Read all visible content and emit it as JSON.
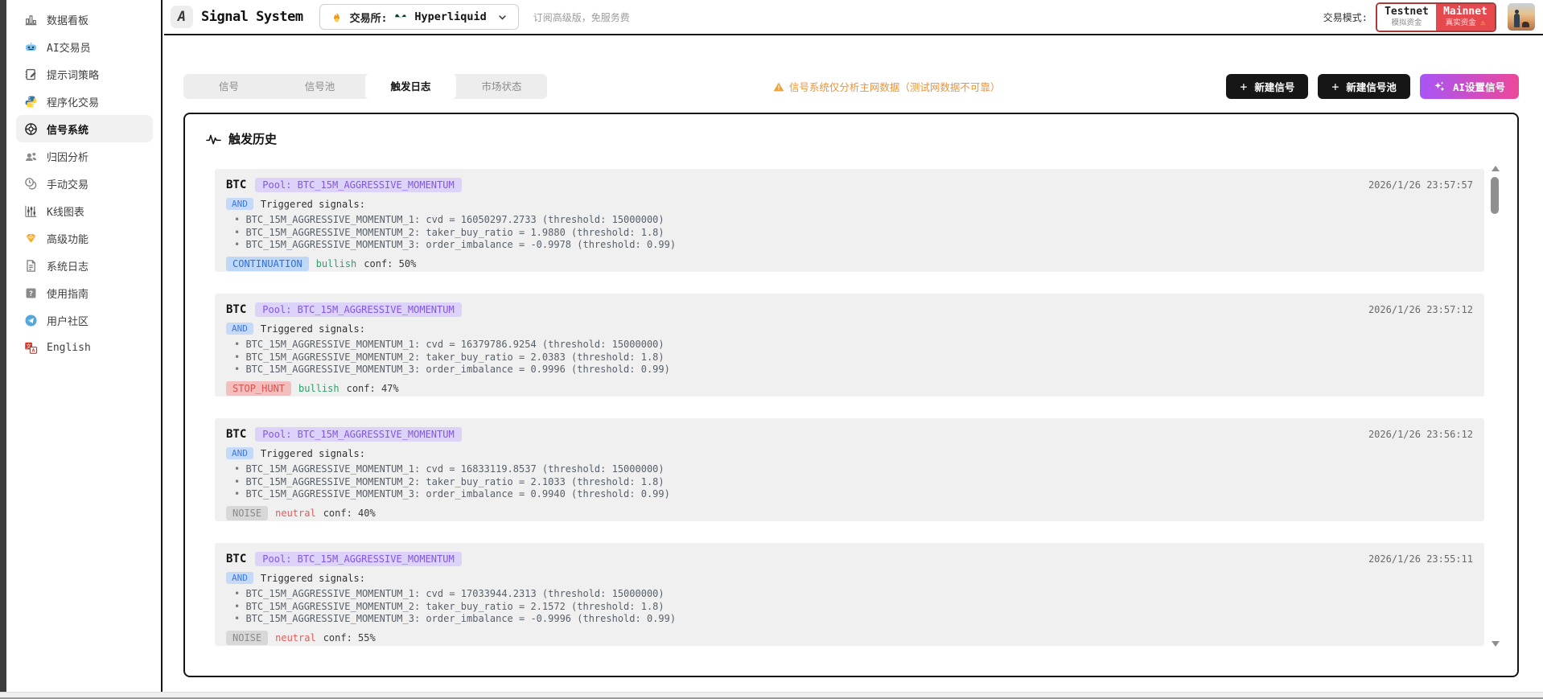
{
  "app": {
    "title": "Signal System",
    "logo_letter": "A"
  },
  "header": {
    "exchange_label": "交易所:",
    "exchange_value": "Hyperliquid",
    "promo": "订阅高级版，免服务费",
    "mode_label": "交易模式:",
    "testnet_title": "Testnet",
    "testnet_sub": "模拟资金",
    "mainnet_title": "Mainnet",
    "mainnet_sub": "真实资金",
    "mainnet_warn": "⚠"
  },
  "sidebar": {
    "items": [
      {
        "key": "dashboard",
        "icon": "bar-chart",
        "label": "数据看板",
        "active": false
      },
      {
        "key": "ai-trader",
        "icon": "robot",
        "label": "AI交易员",
        "active": false
      },
      {
        "key": "prompt-strategy",
        "icon": "notebook",
        "label": "提示词策略",
        "active": false
      },
      {
        "key": "programmatic-trading",
        "icon": "python",
        "label": "程序化交易",
        "active": false
      },
      {
        "key": "signal-system",
        "icon": "target",
        "label": "信号系统",
        "active": true
      },
      {
        "key": "attribution-analysis",
        "icon": "people",
        "label": "归因分析",
        "active": false
      },
      {
        "key": "manual-trading",
        "icon": "coins",
        "label": "手动交易",
        "active": false
      },
      {
        "key": "kline-chart",
        "icon": "candles",
        "label": "K线图表",
        "active": false
      },
      {
        "key": "advanced-features",
        "icon": "gem",
        "label": "高级功能",
        "active": false
      },
      {
        "key": "system-logs",
        "icon": "document",
        "label": "系统日志",
        "active": false
      },
      {
        "key": "user-guide",
        "icon": "question",
        "label": "使用指南",
        "active": false
      },
      {
        "key": "community",
        "icon": "telegram",
        "label": "用户社区",
        "active": false
      },
      {
        "key": "english",
        "icon": "translate",
        "label": "English",
        "active": false
      }
    ]
  },
  "tabs": [
    {
      "key": "signals",
      "label": "信号",
      "active": false
    },
    {
      "key": "signal-pools",
      "label": "信号池",
      "active": false
    },
    {
      "key": "trigger-log",
      "label": "触发日志",
      "active": true
    },
    {
      "key": "market-state",
      "label": "市场状态",
      "active": false
    }
  ],
  "warning": "信号系统仅分析主网数据（测试网数据不可靠）",
  "actions": {
    "new_signal": "新建信号",
    "new_pool": "新建信号池",
    "ai_setup": "AI设置信号"
  },
  "panel": {
    "title": "触发历史"
  },
  "cards": [
    {
      "symbol": "BTC",
      "pool": "Pool: BTC_15M_AGGRESSIVE_MOMENTUM",
      "time": "2026/1/26 23:57:57",
      "logic": "AND",
      "heading": "Triggered signals:",
      "signals": [
        "BTC_15M_AGGRESSIVE_MOMENTUM_1: cvd = 16050297.2733 (threshold: 15000000)",
        "BTC_15M_AGGRESSIVE_MOMENTUM_2: taker_buy_ratio = 1.9880 (threshold: 1.8)",
        "BTC_15M_AGGRESSIVE_MOMENTUM_3: order_imbalance = -0.9978 (threshold: 0.99)"
      ],
      "classification": "CONTINUATION",
      "class_style": "blue",
      "sentiment": "bullish",
      "sentiment_style": "green",
      "conf": "conf: 50%"
    },
    {
      "symbol": "BTC",
      "pool": "Pool: BTC_15M_AGGRESSIVE_MOMENTUM",
      "time": "2026/1/26 23:57:12",
      "logic": "AND",
      "heading": "Triggered signals:",
      "signals": [
        "BTC_15M_AGGRESSIVE_MOMENTUM_1: cvd = 16379786.9254 (threshold: 15000000)",
        "BTC_15M_AGGRESSIVE_MOMENTUM_2: taker_buy_ratio = 2.0383 (threshold: 1.8)",
        "BTC_15M_AGGRESSIVE_MOMENTUM_3: order_imbalance = 0.9996 (threshold: 0.99)"
      ],
      "classification": "STOP_HUNT",
      "class_style": "red",
      "sentiment": "bullish",
      "sentiment_style": "green",
      "conf": "conf: 47%"
    },
    {
      "symbol": "BTC",
      "pool": "Pool: BTC_15M_AGGRESSIVE_MOMENTUM",
      "time": "2026/1/26 23:56:12",
      "logic": "AND",
      "heading": "Triggered signals:",
      "signals": [
        "BTC_15M_AGGRESSIVE_MOMENTUM_1: cvd = 16833119.8537 (threshold: 15000000)",
        "BTC_15M_AGGRESSIVE_MOMENTUM_2: taker_buy_ratio = 2.1033 (threshold: 1.8)",
        "BTC_15M_AGGRESSIVE_MOMENTUM_3: order_imbalance = 0.9940 (threshold: 0.99)"
      ],
      "classification": "NOISE",
      "class_style": "gray",
      "sentiment": "neutral",
      "sentiment_style": "redtext",
      "conf": "conf: 40%"
    },
    {
      "symbol": "BTC",
      "pool": "Pool: BTC_15M_AGGRESSIVE_MOMENTUM",
      "time": "2026/1/26 23:55:11",
      "logic": "AND",
      "heading": "Triggered signals:",
      "signals": [
        "BTC_15M_AGGRESSIVE_MOMENTUM_1: cvd = 17033944.2313 (threshold: 15000000)",
        "BTC_15M_AGGRESSIVE_MOMENTUM_2: taker_buy_ratio = 2.1572 (threshold: 1.8)",
        "BTC_15M_AGGRESSIVE_MOMENTUM_3: order_imbalance = -0.9996 (threshold: 0.99)"
      ],
      "classification": "NOISE",
      "class_style": "gray",
      "sentiment": "neutral",
      "sentiment_style": "redtext",
      "conf": "conf: 55%"
    }
  ],
  "colors": {
    "mainnet_red": "#e5484d",
    "ai_gradient_start": "#a855f7",
    "ai_gradient_end": "#ec4899",
    "warning_orange": "#e8953c",
    "pool_badge_bg": "#ddd2f8",
    "pool_badge_text": "#8257e6",
    "and_badge_bg": "#c5daf8",
    "and_badge_text": "#3f7ae0",
    "continuation_bg": "#bfd8f7",
    "continuation_text": "#2f6fd6",
    "stop_hunt_bg": "#f3bebe",
    "stop_hunt_text": "#d9534f",
    "noise_bg": "#d8d8d8",
    "noise_text": "#8a8a8a",
    "bullish_green": "#2ea36b",
    "neutral_red": "#e05c5c"
  }
}
